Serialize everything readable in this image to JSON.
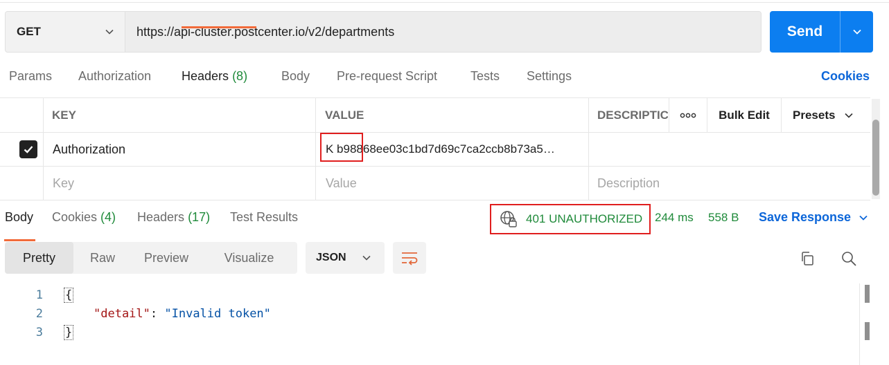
{
  "request": {
    "method": "GET",
    "url": "https://api-cluster.postcenter.io/v2/departments",
    "send_label": "Send"
  },
  "request_tabs": [
    {
      "label": "Params",
      "count": ""
    },
    {
      "label": "Authorization",
      "count": ""
    },
    {
      "label": "Headers",
      "count": "(8)"
    },
    {
      "label": "Body",
      "count": ""
    },
    {
      "label": "Pre-request Script",
      "count": ""
    },
    {
      "label": "Tests",
      "count": ""
    },
    {
      "label": "Settings",
      "count": ""
    }
  ],
  "cookies_link": "Cookies",
  "headers_table": {
    "columns": {
      "key": "KEY",
      "value": "VALUE",
      "description": "DESCRIPTIC"
    },
    "more_label": "ooo",
    "bulk_edit": "Bulk Edit",
    "presets": "Presets",
    "rows": [
      {
        "checked": true,
        "key": "Authorization",
        "value": "K b98868ee03c1bd7d69c7ca2ccb8b73a5…",
        "description": ""
      }
    ],
    "placeholders": {
      "key": "Key",
      "value": "Value",
      "description": "Description"
    }
  },
  "response_tabs": [
    {
      "label": "Body",
      "count": ""
    },
    {
      "label": "Cookies",
      "count": "(4)"
    },
    {
      "label": "Headers",
      "count": "(17)"
    },
    {
      "label": "Test Results",
      "count": ""
    }
  ],
  "response_meta": {
    "status": "401 UNAUTHORIZED",
    "time": "244 ms",
    "size": "558 B",
    "save_response": "Save Response"
  },
  "body_view": {
    "modes": [
      "Pretty",
      "Raw",
      "Preview",
      "Visualize"
    ],
    "active_mode": "Pretty",
    "format": "JSON"
  },
  "code": {
    "line_numbers": [
      "1",
      "2",
      "3"
    ],
    "open_brace": "{",
    "close_brace": "}",
    "key": "\"detail\"",
    "colon": ": ",
    "value": "\"Invalid token\""
  },
  "colors": {
    "accent": "#f26b3a",
    "send": "#0c7ef0",
    "link": "#0c66d9",
    "success": "#1f8a3a",
    "highlight": "#e01e1e"
  }
}
